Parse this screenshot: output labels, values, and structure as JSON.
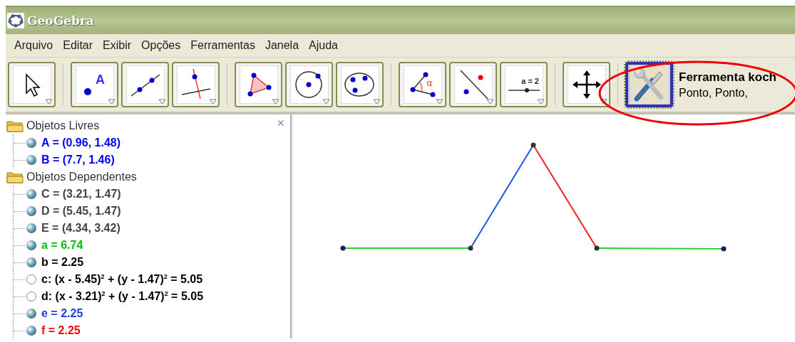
{
  "window": {
    "title": "GeoGebra"
  },
  "menu": [
    "Arquivo",
    "Editar",
    "Exibir",
    "Opções",
    "Ferramentas",
    "Janela",
    "Ajuda"
  ],
  "toolbar": {
    "tools": [
      {
        "selected": false
      },
      {
        "selected": false,
        "icon_text": "A"
      },
      {
        "selected": false
      },
      {
        "selected": false
      },
      {
        "selected": false
      },
      {
        "selected": false
      },
      {
        "selected": false
      },
      {
        "selected": false,
        "icon_text": "α"
      },
      {
        "selected": false
      },
      {
        "selected": false,
        "icon_text": "a = 2"
      },
      {
        "selected": false
      },
      {
        "selected": true
      }
    ],
    "tool_name": "Ferramenta koch",
    "tool_help": "Ponto, Ponto,"
  },
  "algebra": {
    "close": "×",
    "groups": [
      {
        "label": "Objetos Livres",
        "items": [
          {
            "text": "A = (0.96, 1.48)",
            "visible": true,
            "color": "#0000ff"
          },
          {
            "text": "B = (7.7, 1.46)",
            "visible": true,
            "color": "#0000ff"
          }
        ]
      },
      {
        "label": "Objetos Dependentes",
        "items": [
          {
            "text": "C = (3.21, 1.47)",
            "visible": true,
            "color": "#444444"
          },
          {
            "text": "D = (5.45, 1.47)",
            "visible": true,
            "color": "#444444"
          },
          {
            "text": "E = (4.34, 3.42)",
            "visible": true,
            "color": "#444444"
          },
          {
            "text": "a = 6.74",
            "visible": true,
            "color": "#00c000"
          },
          {
            "text": "b = 2.25",
            "visible": true,
            "color": "#000000"
          },
          {
            "text": "c: (x - 5.45)$^{2}$ + (y - 1.47)$^{2}$ = 5.05",
            "visible": false,
            "color": "#000000"
          },
          {
            "text": "d: (x - 3.21)$^{2}$ + (y - 1.47)$^{2}$ = 5.05",
            "visible": false,
            "color": "#000000"
          },
          {
            "text": "e = 2.25",
            "visible": true,
            "color": "#1a3fe0"
          },
          {
            "text": "f = 2.25",
            "visible": true,
            "color": "#ff0000"
          }
        ]
      }
    ]
  }
}
